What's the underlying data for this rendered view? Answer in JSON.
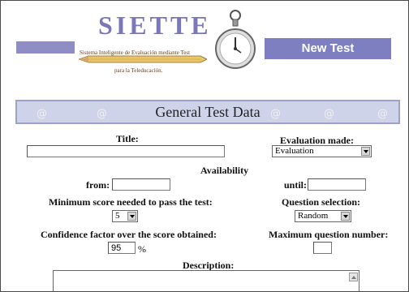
{
  "logo": {
    "title": "SIETTE",
    "subtitle_line1": "Sistema Inteligente de Evaluación mediante Test",
    "subtitle_line2": "para la Teleducación."
  },
  "header": {
    "new_test_label": "New Test"
  },
  "section": {
    "title": "General Test Data"
  },
  "form": {
    "title_label": "Title:",
    "title_value": "",
    "evaluation_mode_label": "Evaluation made:",
    "evaluation_mode_value": "Evaluation",
    "availability_label": "Availability",
    "from_label": "from:",
    "from_value": "",
    "until_label": "until:",
    "until_value": "",
    "min_score_label": "Minimum score needed to pass the test:",
    "min_score_value": "5",
    "question_selection_label": "Question selection:",
    "question_selection_value": "Random",
    "confidence_label": "Confidence factor over the score obtained:",
    "confidence_value": "95",
    "confidence_unit": "%",
    "max_question_label": "Maximum question number:",
    "max_question_value": "",
    "description_label": "Description:",
    "description_value": ""
  },
  "colors": {
    "accent": "#7d7fc1",
    "section_bg": "#cfd3ea"
  }
}
